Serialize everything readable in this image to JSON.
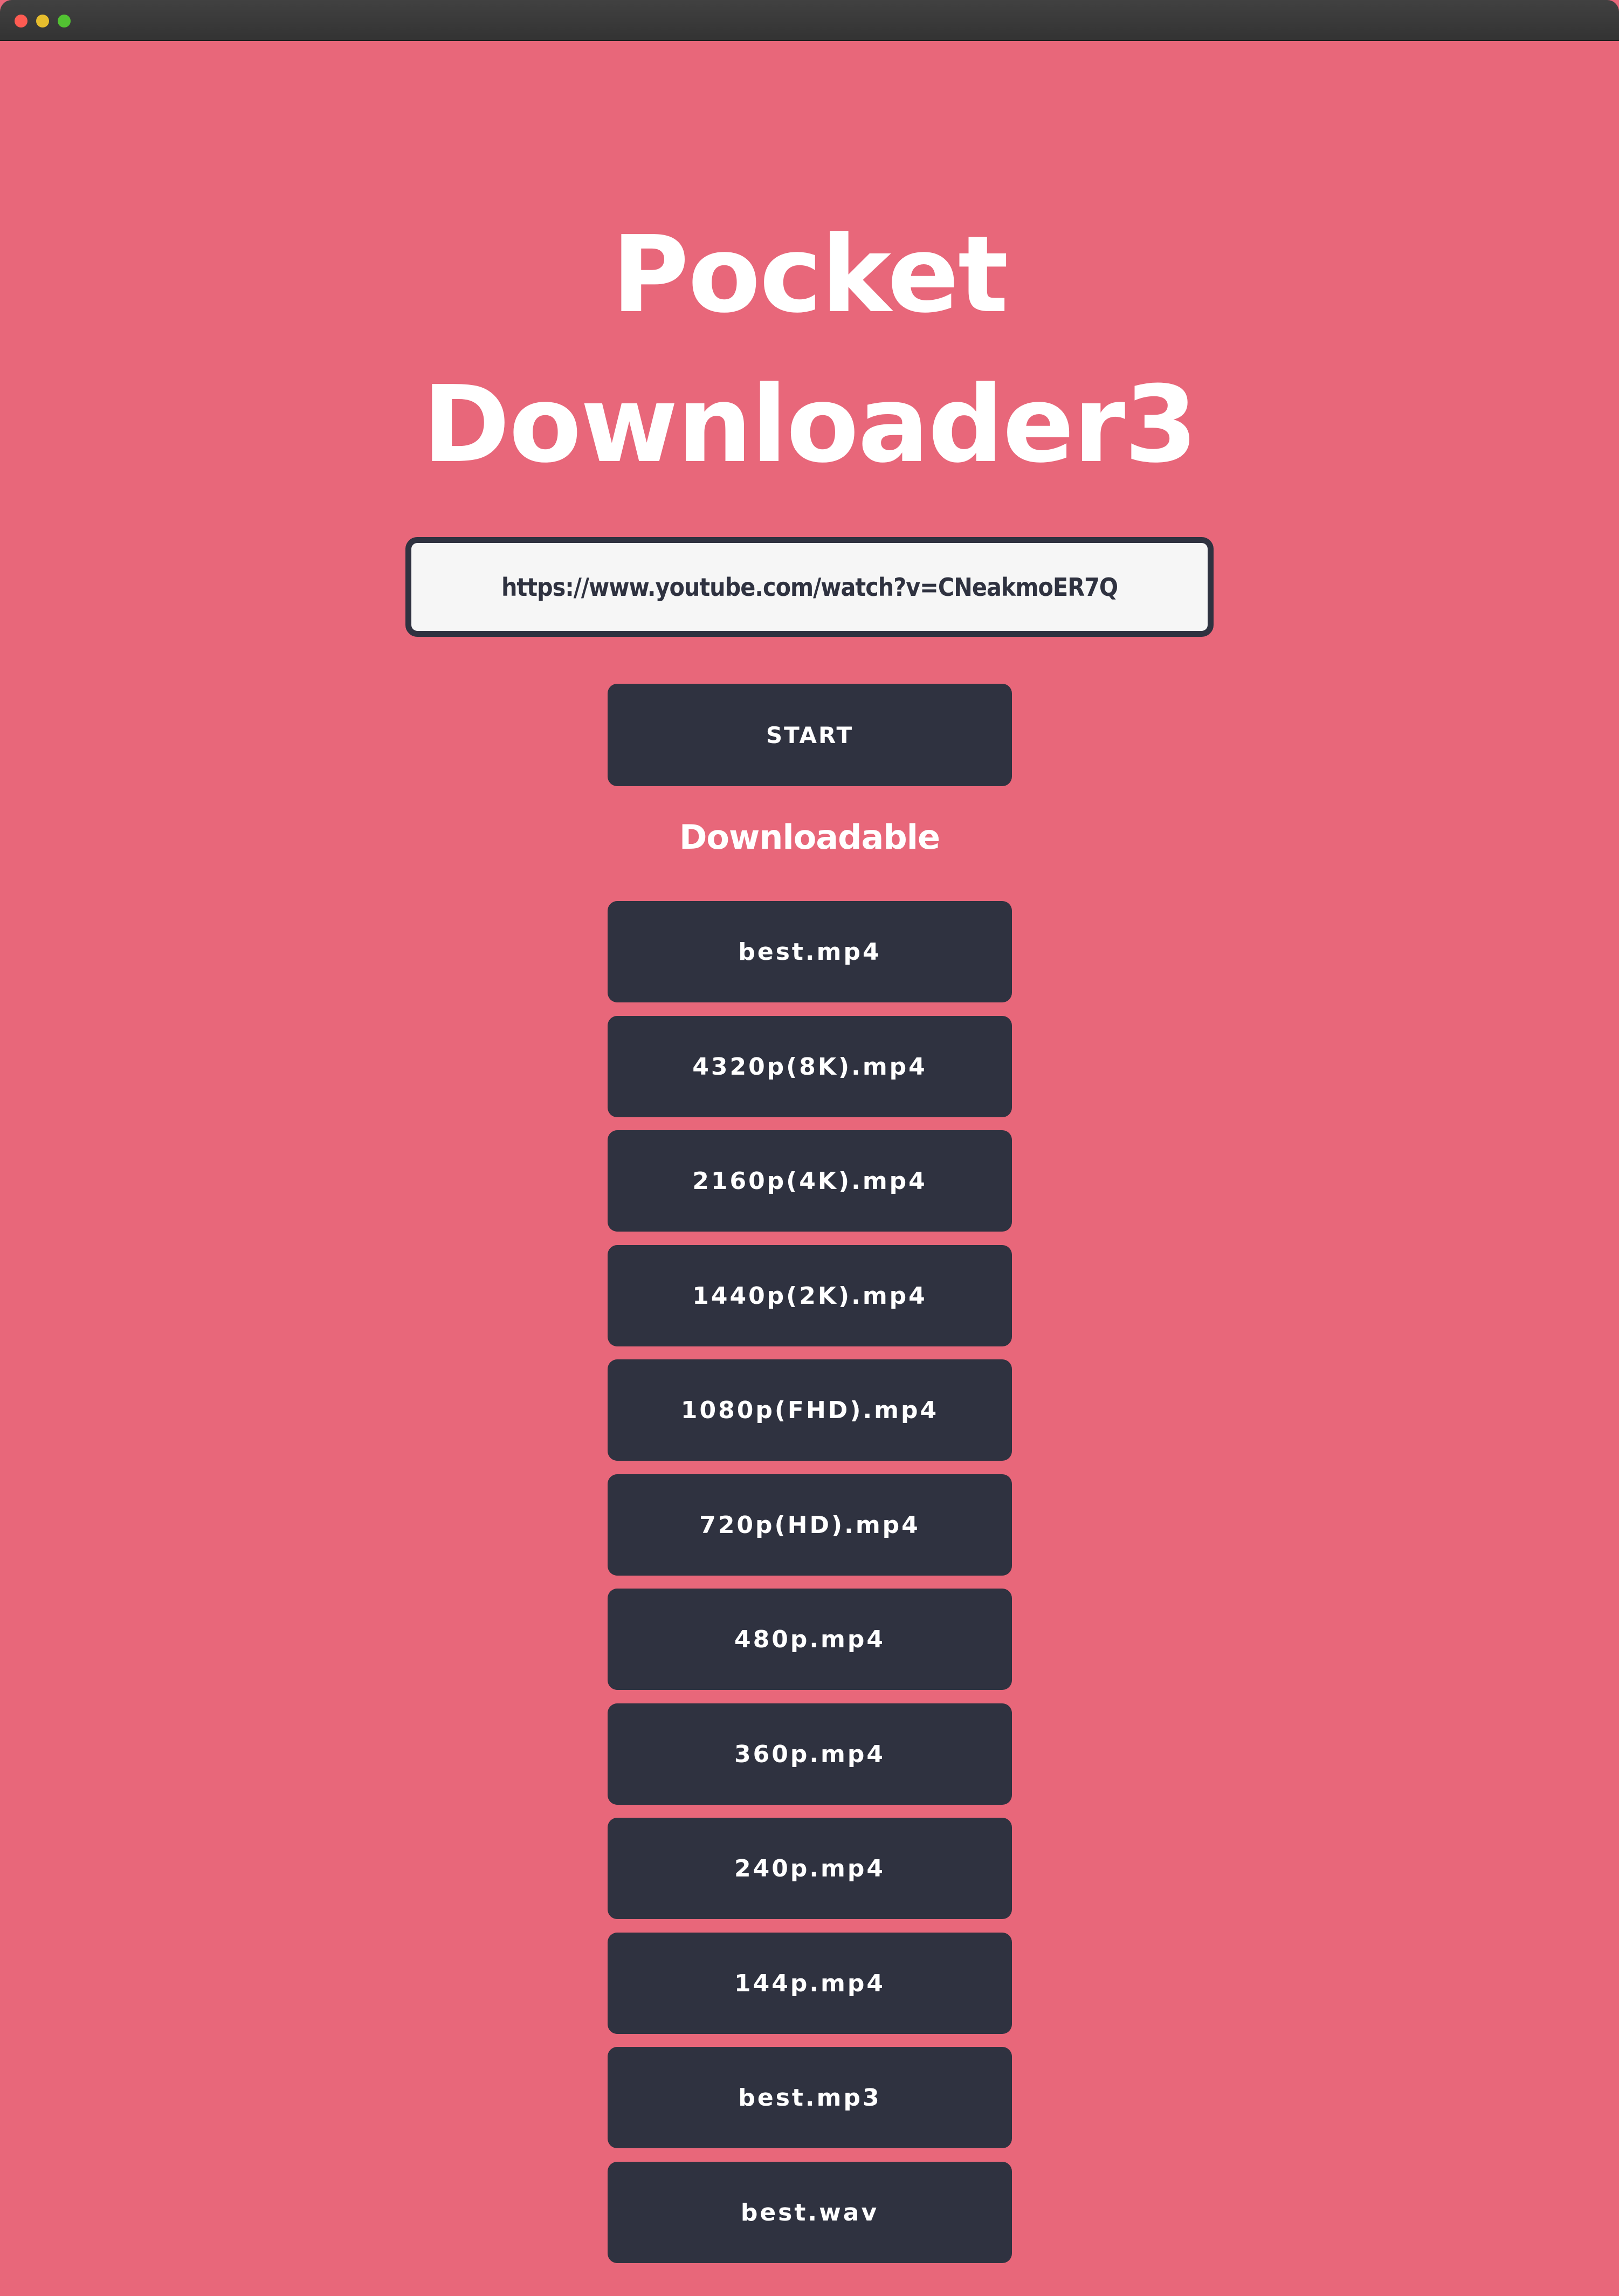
{
  "window": {
    "controls": [
      "close",
      "minimize",
      "maximize"
    ]
  },
  "header": {
    "title_line1": "Pocket",
    "title_line2": "Downloader3"
  },
  "url_input": {
    "value": "https://www.youtube.com/watch?v=CNeakmoER7Q",
    "placeholder": ""
  },
  "start_button": {
    "label": "START"
  },
  "downloads": {
    "heading": "Downloadable",
    "items": [
      {
        "label": "best.mp4"
      },
      {
        "label": "4320p(8K).mp4"
      },
      {
        "label": "2160p(4K).mp4"
      },
      {
        "label": "1440p(2K).mp4"
      },
      {
        "label": "1080p(FHD).mp4"
      },
      {
        "label": "720p(HD).mp4"
      },
      {
        "label": "480p.mp4"
      },
      {
        "label": "360p.mp4"
      },
      {
        "label": "240p.mp4"
      },
      {
        "label": "144p.mp4"
      },
      {
        "label": "best.mp3"
      },
      {
        "label": "best.wav"
      }
    ]
  },
  "colors": {
    "background": "#e8677a",
    "button": "#2f3240",
    "button_text": "#ffffff",
    "input_bg": "#f6f6f6",
    "titlebar": "#3a3a3a"
  }
}
